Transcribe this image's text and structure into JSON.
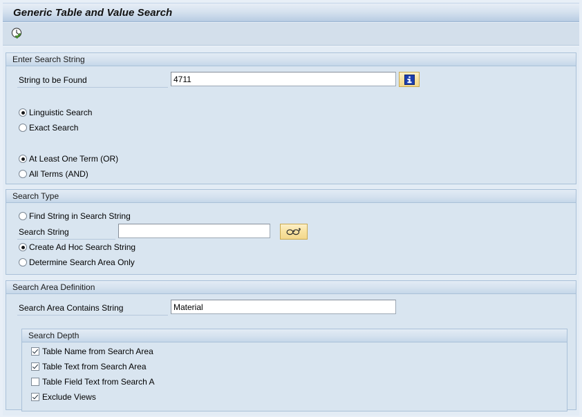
{
  "window": {
    "title": "Generic Table and Value Search"
  },
  "toolbar": {
    "execute_button": {
      "name": "execute-clock-icon",
      "tooltip": "Execute"
    }
  },
  "groups": {
    "enter_search_string": {
      "header": "Enter Search String",
      "string_to_be_found": {
        "label": "String to be Found",
        "value": "4711",
        "placeholder": ""
      },
      "info_button": {
        "icon": "information-icon"
      },
      "search_mode_options": [
        {
          "label": "Linguistic Search",
          "selected": true
        },
        {
          "label": "Exact Search",
          "selected": false
        }
      ],
      "term_logic_options": [
        {
          "label": "At Least One Term (OR)",
          "selected": true
        },
        {
          "label": "All Terms (AND)",
          "selected": false
        }
      ]
    },
    "search_type": {
      "header": "Search Type",
      "options": [
        {
          "label": "Find String in Search String",
          "selected": false
        },
        {
          "label": "Create Ad Hoc Search String",
          "selected": true
        },
        {
          "label": "Determine Search Area Only",
          "selected": false
        }
      ],
      "search_string": {
        "label": "Search String",
        "value": "",
        "placeholder": ""
      },
      "display_button": {
        "icon": "eyeglasses-icon"
      }
    },
    "search_area_definition": {
      "header": "Search Area Definition",
      "search_area_contains_string": {
        "label": "Search Area Contains String",
        "value": "Material",
        "placeholder": ""
      },
      "search_depth": {
        "header": "Search Depth",
        "items": [
          {
            "label": "Table Name from Search Area",
            "checked": true
          },
          {
            "label": "Table Text from Search Area",
            "checked": true
          },
          {
            "label": "Table Field Text from Search A",
            "checked": false
          },
          {
            "label": "Exclude Views",
            "checked": true
          }
        ]
      }
    }
  },
  "colors": {
    "window_background": "#e3ecf5",
    "group_background": "#d9e5f0",
    "titlebar_gradient_end": "#aac3dd",
    "group_border": "#a9c0d8",
    "button_yellow": "#f8e2a0",
    "info_blue": "#1c3faa",
    "check_green": "#4ea11f"
  }
}
